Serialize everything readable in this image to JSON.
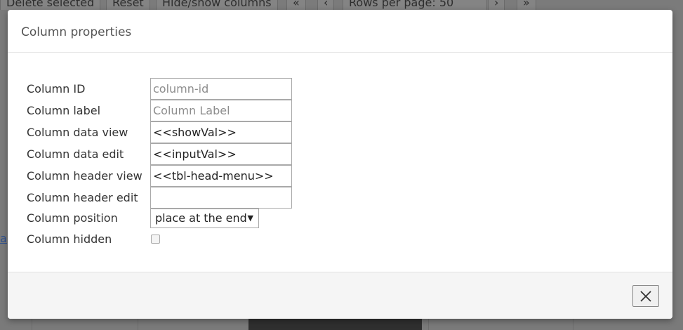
{
  "background": {
    "toolbar": {
      "delete_selected": "Delete selected",
      "reset": "Reset",
      "hide_show_columns": "Hide/show columns",
      "first_page": "«",
      "prev_page": "‹",
      "rows_per_page_label": "Rows per page:",
      "rows_per_page_value": "50",
      "next_page": "›",
      "last_page": "»"
    }
  },
  "modal": {
    "title": "Column properties",
    "fields": {
      "column_id": {
        "label": "Column ID",
        "value": "",
        "placeholder": "column-id"
      },
      "column_label": {
        "label": "Column label",
        "value": "",
        "placeholder": "Column Label"
      },
      "data_view": {
        "label": "Column data view",
        "value": "<<showVal>>"
      },
      "data_edit": {
        "label": "Column data edit",
        "value": "<<inputVal>>"
      },
      "header_view": {
        "label": "Column header view",
        "value": "<<tbl-head-menu>>"
      },
      "header_edit": {
        "label": "Column header edit",
        "value": ""
      },
      "position": {
        "label": "Column position",
        "selected": "place at the end"
      },
      "hidden": {
        "label": "Column hidden",
        "checked": false
      }
    },
    "footer": {
      "close_icon": "close-icon"
    }
  }
}
